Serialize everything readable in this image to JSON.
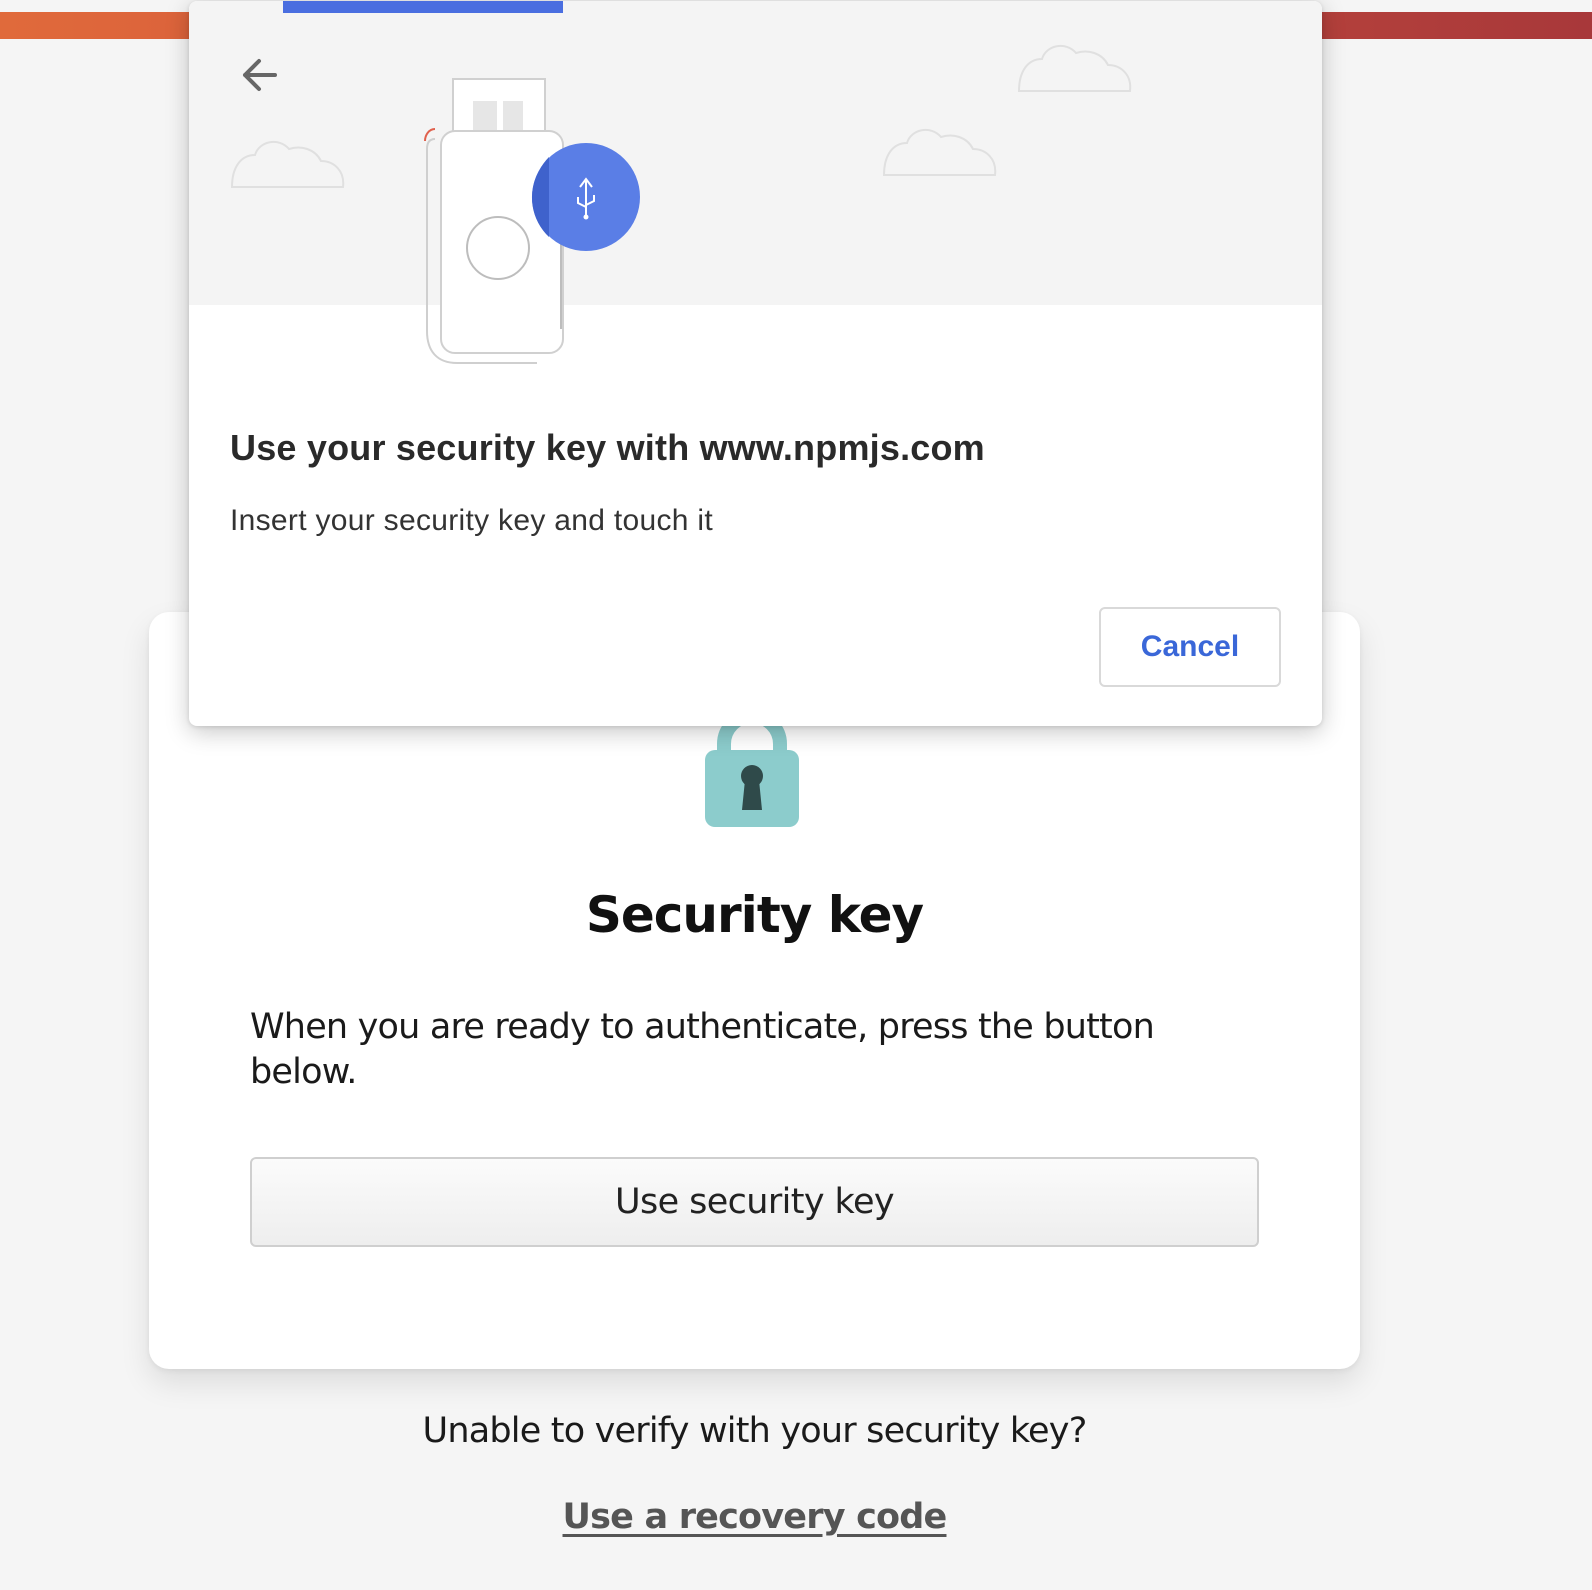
{
  "colors": {
    "top_bar_start": "#e06a3b",
    "top_bar_end": "#a8383a",
    "dialog_accent": "#4a6ee0",
    "lock_body": "#8ccccc",
    "lock_keyhole": "#2f4a4a"
  },
  "webauthn_dialog": {
    "back_icon": "arrow-left-icon",
    "illustration": "usb-security-key",
    "title": "Use your security key with www.npmjs.com",
    "subtitle": "Insert your security key and touch it",
    "cancel_label": "Cancel"
  },
  "card": {
    "icon": "padlock-icon",
    "title": "Security key",
    "description": "When you are ready to authenticate, press the button below.",
    "button_label": "Use security key"
  },
  "footer": {
    "prompt": "Unable to verify with your security key?",
    "link_label": "Use a recovery code"
  }
}
